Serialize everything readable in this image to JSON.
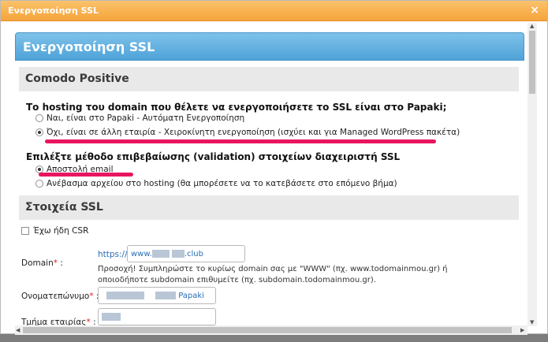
{
  "window": {
    "title": "Ενεργοποίηση SSL",
    "close_glyph": "×"
  },
  "panel": {
    "title": "Ενεργοποίηση SSL"
  },
  "comodo": {
    "title": "Comodo Positive",
    "hosting_question": "Το hosting του domain που θέλετε να ενεργοποιήσετε το SSL είναι στο Papaki;",
    "hosting_options": [
      {
        "label": "Ναι, είναι στο Papaki - Αυτόματη Ενεργοποίηση",
        "selected": false
      },
      {
        "label": "Όχι, είναι σε άλλη εταιρία - Χειροκίνητη ενεργοποίηση (ισχύει και για Managed WordPress πακέτα)",
        "selected": true
      }
    ],
    "validation_question": "Επιλέξτε μέθοδο επιβεβαίωσης (validation) στοιχείων διαχειριστή SSL",
    "validation_options": [
      {
        "label": "Αποστολή email",
        "selected": true
      },
      {
        "label": "Ανέβασμα αρχείου στο hosting (θα μπορέσετε να το κατεβάσετε στο επόμενο βήμα)",
        "selected": false
      }
    ]
  },
  "ssl_details": {
    "title": "Στοιχεία SSL",
    "have_csr_label": "Έχω ήδη CSR",
    "domain_label": "Domain",
    "required_mark": "*",
    "label_colon": ":",
    "https_prefix": "https://",
    "domain_value_start": "www.",
    "domain_value_end": ".club",
    "domain_hint": "Προσοχή! Συμπληρώστε το κυρίως domain σας με \"WWW\" (πχ. www.todomainmou.gr) ή οποιοδήποτε subdomain επιθυμείτε (πχ. subdomain.todomainmou.gr).",
    "name_label": "Ονοματεπώνυμο",
    "name_value_end": "Papaki",
    "company_label": "Τμήμα εταιρίας"
  },
  "colors": {
    "titlebar": "#f5a43a",
    "panel_header": "#4ea2d8",
    "annotation": "#e8155f",
    "link": "#2a6db5"
  }
}
